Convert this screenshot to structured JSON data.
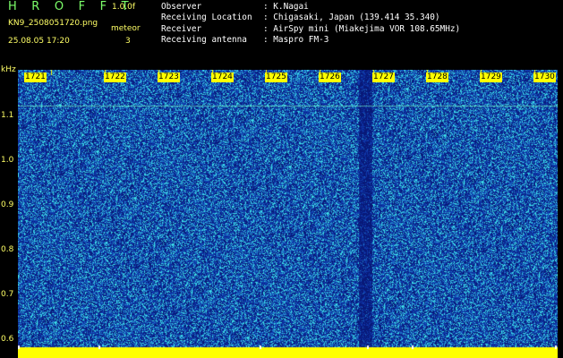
{
  "header": {
    "app_title": "H R O F F T",
    "version": "1.0.0f",
    "filename": "KN9_2508051720.png",
    "mode": "meteor",
    "timestamp": "25.08.05 17:20",
    "count": "3"
  },
  "info": [
    {
      "key": "Observer",
      "value": ": K.Nagai"
    },
    {
      "key": "Receiving Location",
      "value": ": Chigasaki, Japan (139.414 35.340)"
    },
    {
      "key": "Receiver",
      "value": ": AirSpy mini (Miakejima VOR 108.65MHz)"
    },
    {
      "key": "Receiving antenna",
      "value": ": Maspro FM-3"
    }
  ],
  "axis": {
    "unit": "kHz",
    "y_labels": [
      "1.1",
      "1.0",
      "0.9",
      "0.8",
      "0.7",
      "0.6"
    ],
    "x_labels": [
      "1721",
      "1722",
      "1723",
      "1724",
      "1725",
      "1726",
      "1727",
      "1728",
      "1729",
      "1730"
    ]
  },
  "colors": {
    "background": "#0a1f8c",
    "noise_light": "#27c3d6",
    "marker": "#ffff00",
    "label": "#ffff66"
  }
}
